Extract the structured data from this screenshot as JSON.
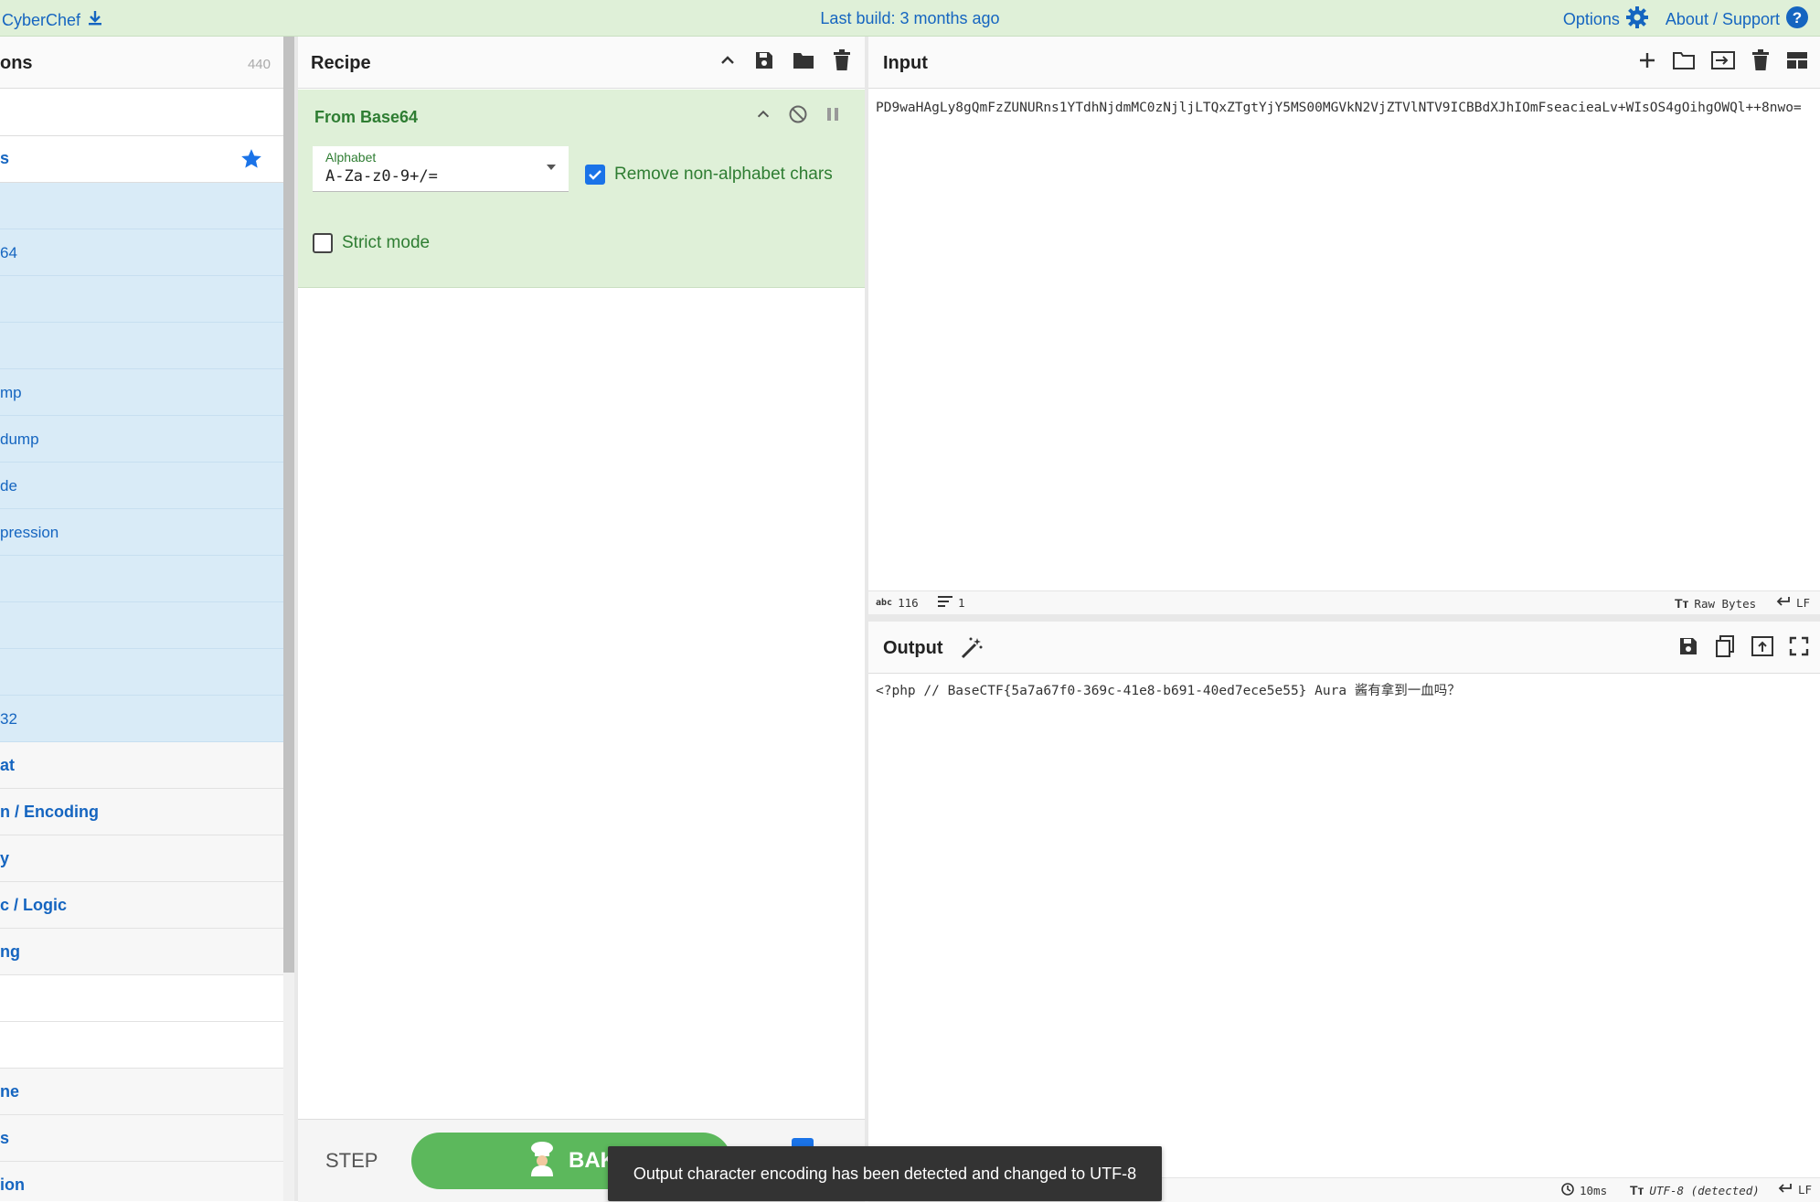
{
  "banner": {
    "app_name": "CyberChef",
    "last_build": "Last build: 3 months ago",
    "options_label": "Options",
    "about_label": "About / Support"
  },
  "operations": {
    "title": "ons",
    "count": "440",
    "favourites_label": "s",
    "items": [
      "",
      "64",
      "",
      "",
      "mp",
      "dump",
      "de",
      "pression",
      "",
      "",
      "",
      "32"
    ],
    "categories": [
      "at",
      "n / Encoding",
      "y",
      "c / Logic",
      "ng",
      "",
      "",
      "ne",
      "s",
      "ion"
    ]
  },
  "recipe": {
    "title": "Recipe",
    "operation": {
      "name": "From Base64",
      "alphabet_label": "Alphabet",
      "alphabet_value": "A-Za-z0-9+/=",
      "remove_non_alpha_label": "Remove non-alphabet chars",
      "remove_non_alpha_checked": true,
      "strict_mode_label": "Strict mode",
      "strict_mode_checked": false
    },
    "step_label": "STEP",
    "bake_label": "BAK"
  },
  "input": {
    "title": "Input",
    "text": "PD9waHAgLy8gQmFzZUNURns1YTdhNjdmMC0zNjljLTQxZTgtYjY5MS00MGVkN2VjZTVlNTV9ICBBdXJhIOmFseacieaLv+WIsOS4gOihgOWQl++8nwo=",
    "status_chars": "116",
    "status_lines": "1",
    "status_encoding": "Raw Bytes",
    "status_eol": "LF"
  },
  "output": {
    "title": "Output",
    "text": "<?php // BaseCTF{5a7a67f0-369c-41e8-b691-40ed7ece5e55}  Aura 酱有拿到一血吗？",
    "status_time": "10ms",
    "status_encoding": "UTF-8 (detected)",
    "status_eol": "LF"
  },
  "toast": {
    "message": "Output character encoding has been detected and changed to UTF-8"
  },
  "colors": {
    "accent": "#1565c0",
    "recipe_green": "#dff0d8",
    "bake_green": "#5cb85c",
    "op_blue": "#d9ebf7"
  }
}
